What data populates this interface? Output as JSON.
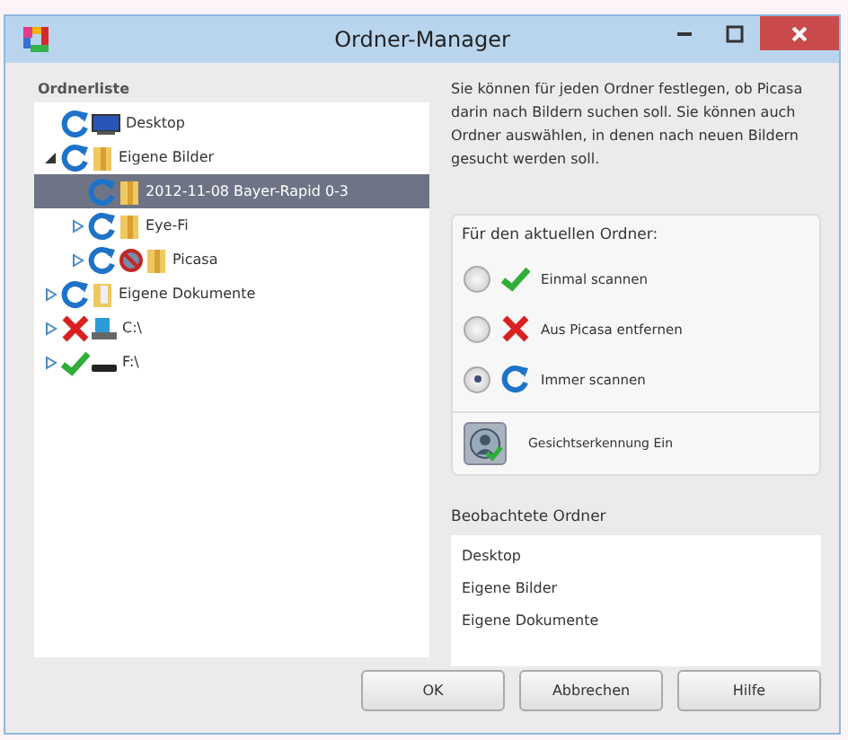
{
  "window": {
    "title": "Ordner-Manager"
  },
  "folder_list": {
    "label": "Ordnerliste",
    "tree": [
      {
        "label": "Desktop",
        "scan": {
          "kind": "always"
        },
        "icon": {
          "kind": "desktop"
        },
        "selected": false
      },
      {
        "label": "Eigene Bilder",
        "scan": {
          "kind": "always"
        },
        "icon": {
          "kind": "folder"
        },
        "expanded": true,
        "selected": false,
        "children": [
          {
            "label": "2012-11-08 Bayer-Rapid 0-3",
            "scan": {
              "kind": "always"
            },
            "icon": {
              "kind": "folder"
            },
            "selected": true
          },
          {
            "label": "Eye-Fi",
            "scan": {
              "kind": "always"
            },
            "icon": {
              "kind": "folder"
            },
            "expanded": false,
            "selected": false
          },
          {
            "label": "Picasa",
            "scan": {
              "kind": "always"
            },
            "icon": {
              "kind": "folder"
            },
            "expanded": false,
            "selected": false,
            "blocked": true
          }
        ]
      },
      {
        "label": "Eigene Dokumente",
        "scan": {
          "kind": "always"
        },
        "icon": {
          "kind": "documents"
        },
        "expanded": false,
        "selected": false
      },
      {
        "label": "C:\\",
        "scan": {
          "kind": "remove"
        },
        "icon": {
          "kind": "drive"
        },
        "expanded": false,
        "selected": false
      },
      {
        "label": "F:\\",
        "scan": {
          "kind": "once"
        },
        "icon": {
          "kind": "usb"
        },
        "expanded": false,
        "selected": false
      }
    ]
  },
  "description": "Sie können für jeden Ordner festlegen, ob Picasa darin nach Bildern suchen soll. Sie können auch Ordner auswählen, in denen nach neuen Bildern gesucht werden soll.",
  "current_folder": {
    "heading": "Für den aktuellen Ordner:",
    "options": [
      {
        "label": "Einmal scannen",
        "kind": "once",
        "selected": false
      },
      {
        "label": "Aus Picasa entfernen",
        "kind": "remove",
        "selected": false
      },
      {
        "label": "Immer scannen",
        "kind": "always",
        "selected": true
      }
    ],
    "face_recognition": {
      "label": "Gesichtserkennung Ein",
      "on": true
    }
  },
  "watched": {
    "heading": "Beobachtete Ordner",
    "items": [
      "Desktop",
      "Eigene Bilder",
      "Eigene Dokumente"
    ]
  },
  "buttons": [
    "OK",
    "Abbrechen",
    "Hilfe"
  ]
}
